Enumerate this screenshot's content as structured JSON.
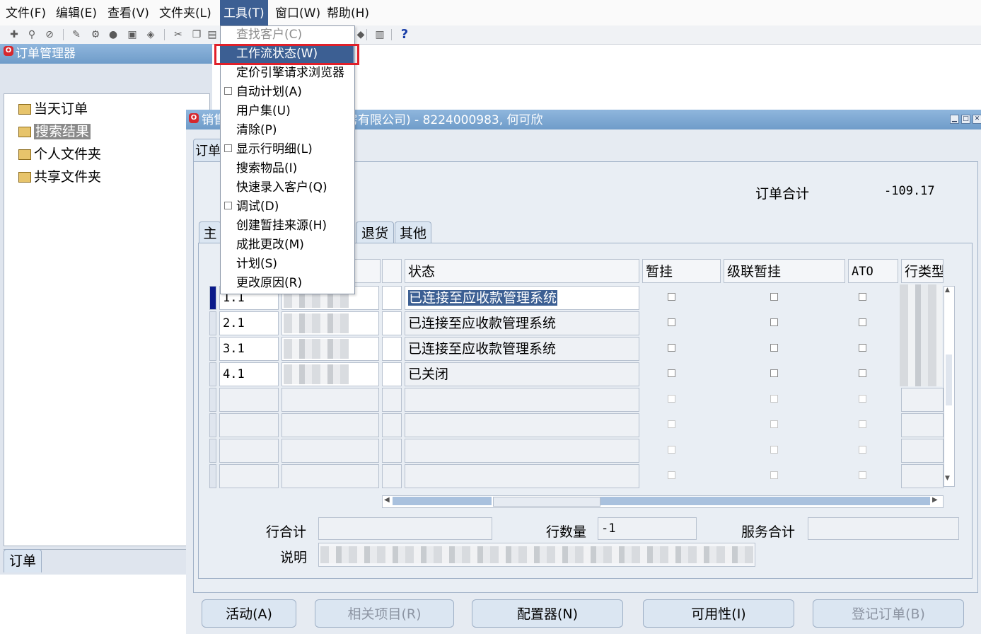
{
  "menubar": {
    "items": [
      "文件(F)",
      "编辑(E)",
      "查看(V)",
      "文件夹(L)",
      "工具(T)",
      "窗口(W)",
      "帮助(H)"
    ],
    "active_index": 4
  },
  "toolbar": {
    "icons": [
      "new-record-icon",
      "find-icon",
      "navigate-icon",
      "save-icon",
      "next-step-icon",
      "print-icon",
      "close-form-icon",
      "cut-icon",
      "copy-icon",
      "paste-icon",
      "translation-icon",
      "attachments-icon",
      "help-icon"
    ],
    "help_glyph": "?"
  },
  "tools_menu": {
    "items": [
      {
        "label": "查找客户(C)",
        "disabled": true,
        "check": false
      },
      {
        "label": "工作流状态(W)",
        "disabled": false,
        "check": false,
        "highlighted": true
      },
      {
        "label": "定价引擎请求浏览器",
        "disabled": false,
        "check": false
      },
      {
        "label": "自动计划(A)",
        "disabled": false,
        "check": true
      },
      {
        "label": "用户集(U)",
        "disabled": false,
        "check": false
      },
      {
        "label": "清除(P)",
        "disabled": false,
        "check": false
      },
      {
        "label": "显示行明细(L)",
        "disabled": false,
        "check": true
      },
      {
        "label": "搜索物品(I)",
        "disabled": false,
        "check": false
      },
      {
        "label": "快速录入客户(Q)",
        "disabled": false,
        "check": false
      },
      {
        "label": "调试(D)",
        "disabled": false,
        "check": true
      },
      {
        "label": "创建暂挂来源(H)",
        "disabled": false,
        "check": false
      },
      {
        "label": "成批更改(M)",
        "disabled": false,
        "check": false
      },
      {
        "label": "计划(S)",
        "disabled": false,
        "check": false
      },
      {
        "label": "更改原因(R)",
        "disabled": false,
        "check": false
      }
    ]
  },
  "organizer": {
    "title": "订单管理器",
    "tree": [
      {
        "label": "当天订单",
        "selected": false,
        "expandable": false
      },
      {
        "label": "搜索结果",
        "selected": true,
        "expandable": false
      },
      {
        "label": "个人文件夹",
        "selected": false,
        "expandable": true
      },
      {
        "label": "共享文件夹",
        "selected": false,
        "expandable": true
      }
    ],
    "bottom_tab": "订单"
  },
  "sales_window": {
    "title_prefix": "销售",
    "title_suffix": "房有限公司) - 8224000983, 何可欣",
    "outer_tab": "订单",
    "order_total_label": "订单合计",
    "order_total_value": "-109.17",
    "inner_tabs": [
      "主",
      "退货",
      "其他"
    ],
    "columns": {
      "status": "状态",
      "hold": "暂挂",
      "cascade_hold": "级联暂挂",
      "ato": "ATO",
      "line_type": "行类型"
    },
    "rows": [
      {
        "line": "1.1",
        "status": "已连接至应收款管理系统",
        "selected": true
      },
      {
        "line": "2.1",
        "status": "已连接至应收款管理系统",
        "selected": false
      },
      {
        "line": "3.1",
        "status": "已连接至应收款管理系统",
        "selected": false
      },
      {
        "line": "4.1",
        "status": "已关闭",
        "selected": false
      }
    ],
    "empty_rows": 4,
    "line_total_label": "行合计",
    "line_count_label": "行数量",
    "line_count_value": "-1",
    "service_total_label": "服务合计",
    "description_label": "说明",
    "buttons": [
      {
        "label": "活动(A)",
        "disabled": false
      },
      {
        "label": "相关项目(R)",
        "disabled": true
      },
      {
        "label": "配置器(N)",
        "disabled": false
      },
      {
        "label": "可用性(I)",
        "disabled": false
      },
      {
        "label": "登记订单(B)",
        "disabled": true
      }
    ],
    "window_controls": [
      "minimize-icon",
      "maximize-icon",
      "close-icon"
    ]
  },
  "colors": {
    "menu_active": "#3c5f93",
    "highlight_box": "#e0202a",
    "titlebar": "#7ea8d3"
  }
}
